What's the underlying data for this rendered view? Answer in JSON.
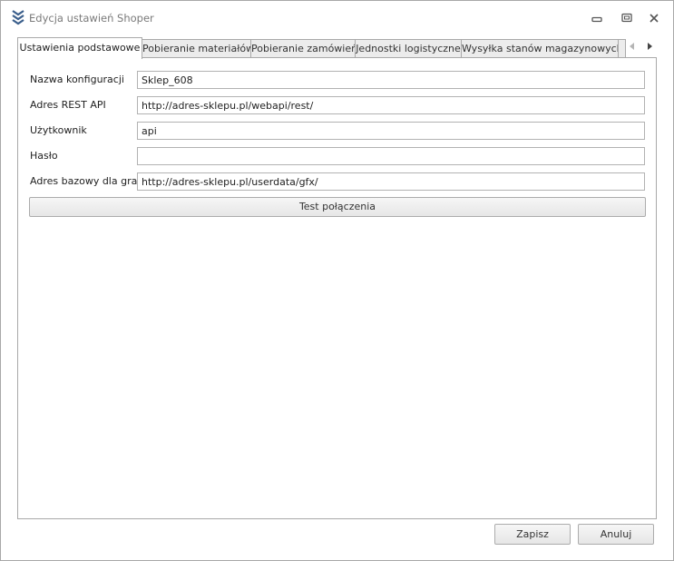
{
  "window": {
    "title": "Edycja ustawień Shoper"
  },
  "tabs": [
    {
      "label": "Ustawienia podstawowe",
      "active": true
    },
    {
      "label": "Pobieranie materiałów",
      "active": false
    },
    {
      "label": "Pobieranie zamówień",
      "active": false
    },
    {
      "label": "Jednostki logistyczne",
      "active": false
    },
    {
      "label": "Wysyłka stanów magazynowych",
      "active": false
    }
  ],
  "form": {
    "config_name_label": "Nazwa konfiguracji",
    "config_name_value": "Sklep_608",
    "rest_api_label": "Adres REST API",
    "rest_api_value": "http://adres-sklepu.pl/webapi/rest/",
    "user_label": "Użytkownik",
    "user_value": "api",
    "password_label": "Hasło",
    "password_value": "",
    "image_base_label": "Adres bazowy dla grafik",
    "image_base_value": "http://adres-sklepu.pl/userdata/gfx/",
    "test_button": "Test połączenia"
  },
  "footer": {
    "save_label": "Zapisz",
    "cancel_label": "Anuluj"
  },
  "colors": {
    "accent_icon": "#3b5f8c",
    "border": "#a9a9a9"
  }
}
